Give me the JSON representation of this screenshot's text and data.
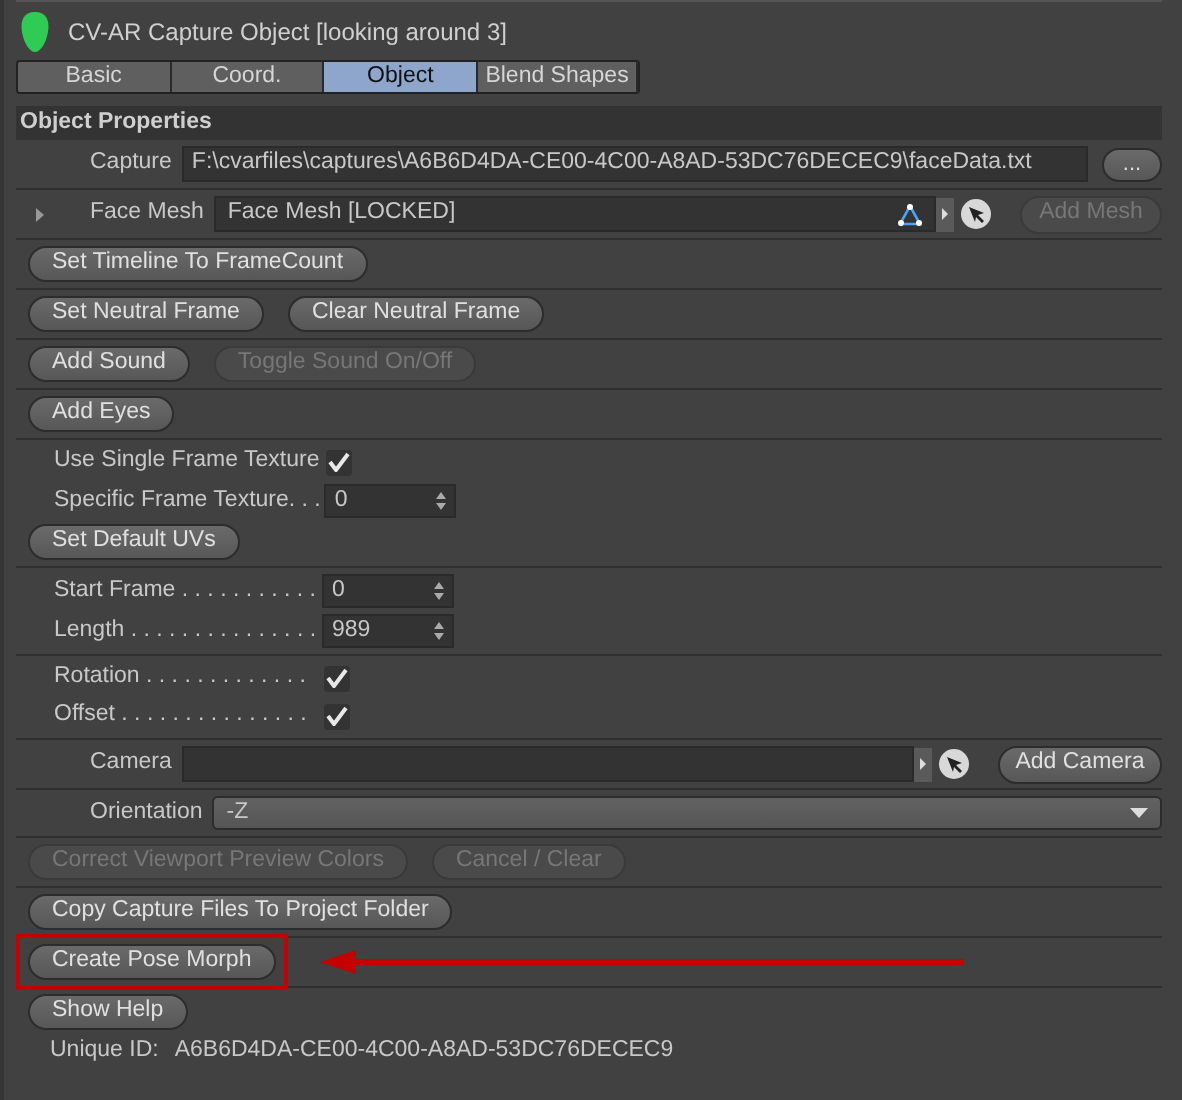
{
  "window": {
    "title": "CV-AR Capture Object [looking around 3]"
  },
  "tabs": [
    {
      "label": "Basic",
      "selected": false
    },
    {
      "label": "Coord.",
      "selected": false
    },
    {
      "label": "Object",
      "selected": true
    },
    {
      "label": "Blend Shapes",
      "selected": false
    }
  ],
  "section_title": "Object Properties",
  "groups": [
    {
      "rows": [
        {
          "kind": "file",
          "label": "Capture",
          "value": "F:\\cvarfiles\\captures\\A6B6D4DA-CE00-4C00-A8AD-53DC76DECEC9\\faceData.txt",
          "button": "..."
        }
      ]
    },
    {
      "rows": [
        {
          "kind": "link",
          "label": "Face Mesh",
          "value": "Face Mesh [LOCKED]",
          "expander": true,
          "button": {
            "label": "Add Mesh",
            "disabled": true
          }
        }
      ]
    },
    {
      "rows": [
        {
          "kind": "buttons",
          "buttons": [
            {
              "label": "Set Timeline To FrameCount",
              "disabled": false,
              "highlighted": false
            }
          ]
        }
      ]
    },
    {
      "rows": [
        {
          "kind": "buttons",
          "buttons": [
            {
              "label": "Set Neutral Frame",
              "disabled": false,
              "highlighted": false
            },
            {
              "label": "Clear Neutral Frame",
              "disabled": false,
              "highlighted": false
            }
          ]
        }
      ]
    },
    {
      "rows": [
        {
          "kind": "buttons",
          "buttons": [
            {
              "label": "Add Sound",
              "disabled": false,
              "highlighted": false
            },
            {
              "label": "Toggle Sound On/Off",
              "disabled": true,
              "highlighted": false
            }
          ]
        }
      ]
    },
    {
      "rows": [
        {
          "kind": "buttons",
          "buttons": [
            {
              "label": "Add Eyes",
              "disabled": false,
              "highlighted": false
            }
          ]
        }
      ]
    },
    {
      "rows": [
        {
          "kind": "checkbox",
          "label": "Use Single Frame Texture",
          "checked": true
        },
        {
          "kind": "number",
          "label": "Specific Frame Texture. . .",
          "value": "0"
        },
        {
          "kind": "buttons",
          "buttons": [
            {
              "label": "Set Default UVs",
              "disabled": false,
              "highlighted": false
            }
          ]
        }
      ]
    },
    {
      "rows": [
        {
          "kind": "number",
          "label": "Start Frame . . . . . . . . . . .",
          "value": "0"
        },
        {
          "kind": "number",
          "label": "Length . . . . . . . . . . . . . . .",
          "value": "989"
        }
      ]
    },
    {
      "rows": [
        {
          "kind": "checkbox",
          "label": "Rotation . . . . . . . . . . . . .",
          "checked": true
        },
        {
          "kind": "checkbox",
          "label": "Offset . . . . . . . . . . . . . . .",
          "checked": true
        }
      ]
    },
    {
      "rows": [
        {
          "kind": "link",
          "label": "Camera",
          "value": "",
          "expander": false,
          "button": {
            "label": "Add Camera",
            "disabled": false
          }
        }
      ]
    },
    {
      "rows": [
        {
          "kind": "dropdown",
          "label": "Orientation",
          "value": "-Z"
        }
      ]
    },
    {
      "rows": [
        {
          "kind": "buttons",
          "buttons": [
            {
              "label": "Correct Viewport Preview Colors",
              "disabled": true,
              "highlighted": false
            },
            {
              "label": "Cancel / Clear",
              "disabled": true,
              "highlighted": false
            }
          ]
        }
      ]
    },
    {
      "rows": [
        {
          "kind": "buttons",
          "buttons": [
            {
              "label": "Copy Capture Files To Project Folder",
              "disabled": false,
              "highlighted": false
            }
          ]
        }
      ]
    },
    {
      "rows": [
        {
          "kind": "buttons",
          "buttons": [
            {
              "label": "Create Pose Morph",
              "disabled": false,
              "highlighted": true
            }
          ]
        }
      ]
    },
    {
      "rows": [
        {
          "kind": "buttons",
          "buttons": [
            {
              "label": "Show Help",
              "disabled": false,
              "highlighted": false
            }
          ]
        },
        {
          "kind": "info",
          "label": "Unique ID:",
          "value": "A6B6D4DA-CE00-4C00-A8AD-53DC76DECEC9"
        }
      ]
    }
  ]
}
